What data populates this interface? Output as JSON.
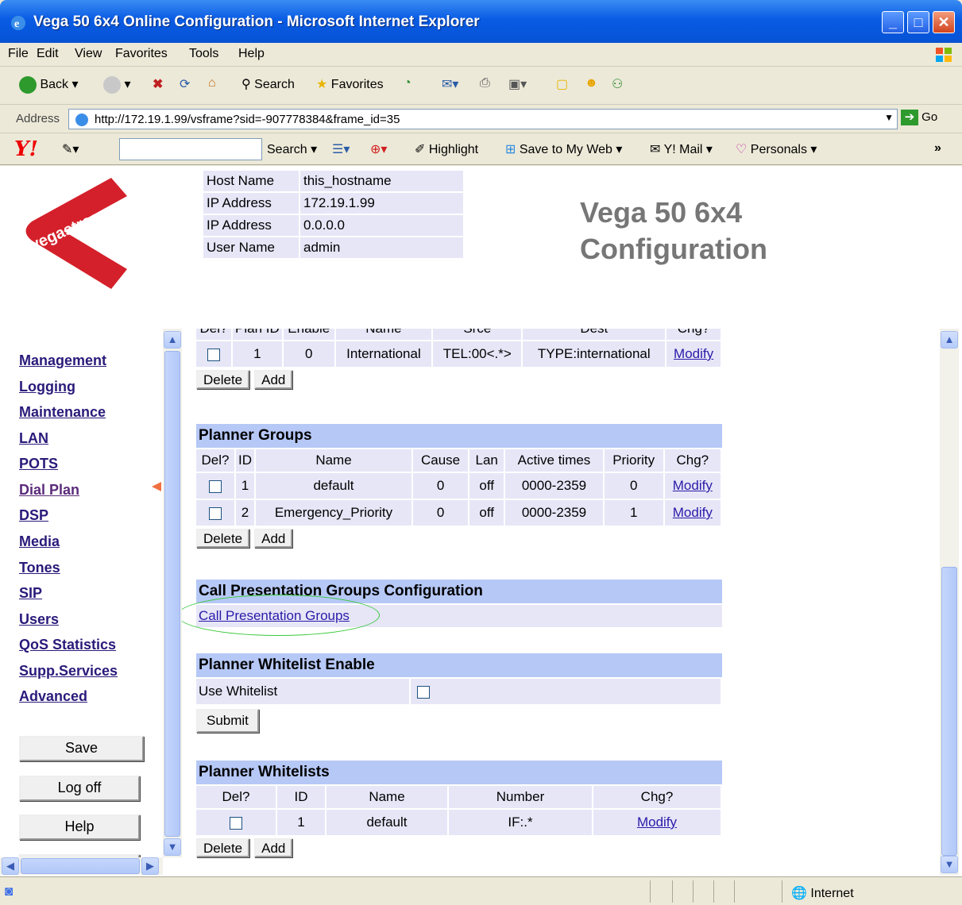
{
  "window": {
    "title": "Vega 50 6x4 Online Configuration - Microsoft Internet Explorer"
  },
  "menu": [
    "File",
    "Edit",
    "View",
    "Favorites",
    "Tools",
    "Help"
  ],
  "toolbar": {
    "back": "Back",
    "search": "Search",
    "favorites": "Favorites"
  },
  "address": {
    "label": "Address",
    "url": "http://172.19.1.99/vsframe?sid=-907778384&frame_id=35",
    "go": "Go"
  },
  "yahoo_bar": {
    "logo": "Y!",
    "search": "Search",
    "highlight": "Highlight",
    "save_to_my_web": "Save to My Web",
    "mail": "Y! Mail",
    "personals": "Personals",
    "more": "»"
  },
  "header": {
    "logo_text": "vegastream",
    "info": [
      {
        "key": "Host Name",
        "value": "this_hostname"
      },
      {
        "key": "IP Address",
        "value": "172.19.1.99"
      },
      {
        "key": "IP Address",
        "value": "0.0.0.0"
      },
      {
        "key": "User Name",
        "value": "admin"
      }
    ],
    "title_line1": "Vega 50 6x4",
    "title_line2": "Configuration"
  },
  "nav": {
    "items": [
      "Management",
      "Logging",
      "Maintenance",
      "LAN",
      "POTS",
      "Dial Plan",
      "DSP",
      "Media",
      "Tones",
      "SIP",
      "Users",
      "QoS Statistics",
      "Supp.Services",
      "Advanced"
    ],
    "active": "Dial Plan",
    "buttons": [
      "Save",
      "Log off",
      "Help"
    ]
  },
  "plans": {
    "headers_partial": [
      "Del?",
      "Plan ID",
      "Enable",
      "Name",
      "Srce",
      "Dest",
      "Chg?"
    ],
    "row": {
      "id": "1",
      "enable": "0",
      "name": "International",
      "srce": "TEL:00<.*>",
      "dest": "TYPE:international",
      "chg": "Modify"
    }
  },
  "buttons": {
    "delete": "Delete",
    "add": "Add",
    "submit": "Submit"
  },
  "planner_groups": {
    "title": "Planner Groups",
    "headers": [
      "Del?",
      "ID",
      "Name",
      "Cause",
      "Lan",
      "Active times",
      "Priority",
      "Chg?"
    ],
    "rows": [
      {
        "id": "1",
        "name": "default",
        "cause": "0",
        "lan": "off",
        "times": "0000-2359",
        "priority": "0",
        "chg": "Modify"
      },
      {
        "id": "2",
        "name": "Emergency_Priority",
        "cause": "0",
        "lan": "off",
        "times": "0000-2359",
        "priority": "1",
        "chg": "Modify"
      }
    ]
  },
  "call_presentation": {
    "title": "Call Presentation Groups Configuration",
    "link": "Call Presentation Groups"
  },
  "whitelist_enable": {
    "title": "Planner Whitelist Enable",
    "label": "Use Whitelist"
  },
  "whitelists": {
    "title": "Planner Whitelists",
    "headers": [
      "Del?",
      "ID",
      "Name",
      "Number",
      "Chg?"
    ],
    "rows": [
      {
        "id": "1",
        "name": "default",
        "number": "IF:.*",
        "chg": "Modify"
      }
    ]
  },
  "status": {
    "zone": "Internet"
  },
  "colors": {
    "section_header": "#b6c8f6",
    "cell": "#e6e6f7",
    "nav_link": "#2a1a7a",
    "logo_red": "#d4202a",
    "highlight_ellipse": "#38c838"
  }
}
